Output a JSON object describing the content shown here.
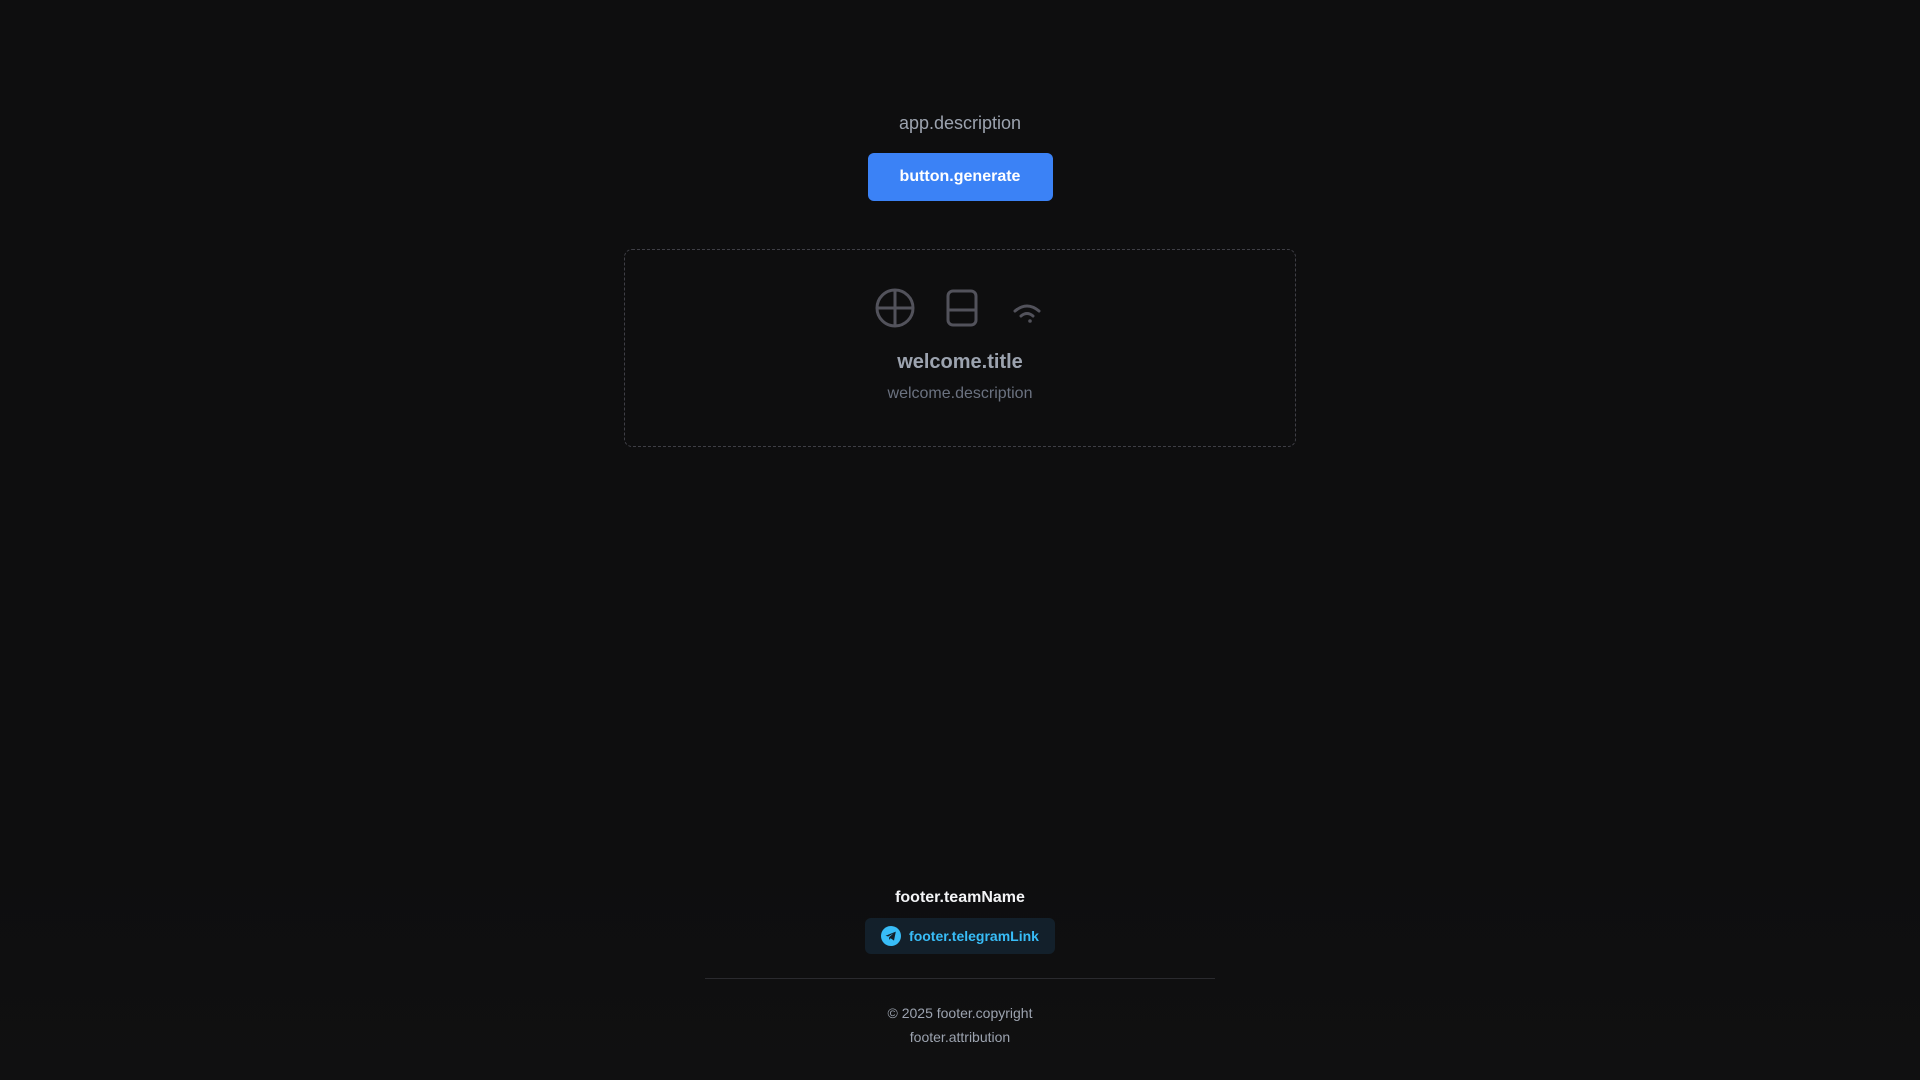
{
  "app": {
    "description": "app.description"
  },
  "toolbar": {
    "generate_label": "button.generate"
  },
  "welcome": {
    "icons": [
      "globe-icon",
      "tablet-icon",
      "wifi-icon"
    ],
    "title": "welcome.title",
    "description": "welcome.description"
  },
  "footer": {
    "team_name": "footer.teamName",
    "telegram_label": "footer.telegramLink",
    "telegram_icon": "telegram-icon",
    "copyright_year": "© 2025",
    "copyright_text": "footer.copyright",
    "attribution": "footer.attribution"
  },
  "colors": {
    "background": "#0e0e0f",
    "accent": "#3b82f6",
    "telegram": "#38bdf8",
    "muted_text": "#9ca3af",
    "icon": "#52525b"
  }
}
